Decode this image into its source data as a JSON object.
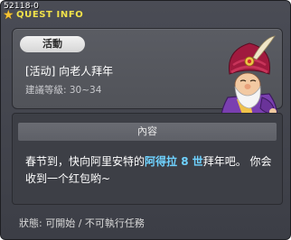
{
  "window": {
    "quest_id": "52118-0",
    "title": "QUEST INFO"
  },
  "summary": {
    "badge": "活動",
    "quest_name": "[活动] 向老人拜年",
    "level_range": "建議等級: 30~34"
  },
  "content": {
    "header": "內容",
    "text_before": "春节到，快向阿里安特的",
    "npc_name": "阿得拉 8 世",
    "text_after": "拜年吧。 你会收到一个红包哟~"
  },
  "status": {
    "text": "狀態: 可開始 / 不可執行任務"
  },
  "colors": {
    "title": "#f1e24a",
    "npc_highlight": "#6fd2ff",
    "turban": "#a01a3e"
  }
}
